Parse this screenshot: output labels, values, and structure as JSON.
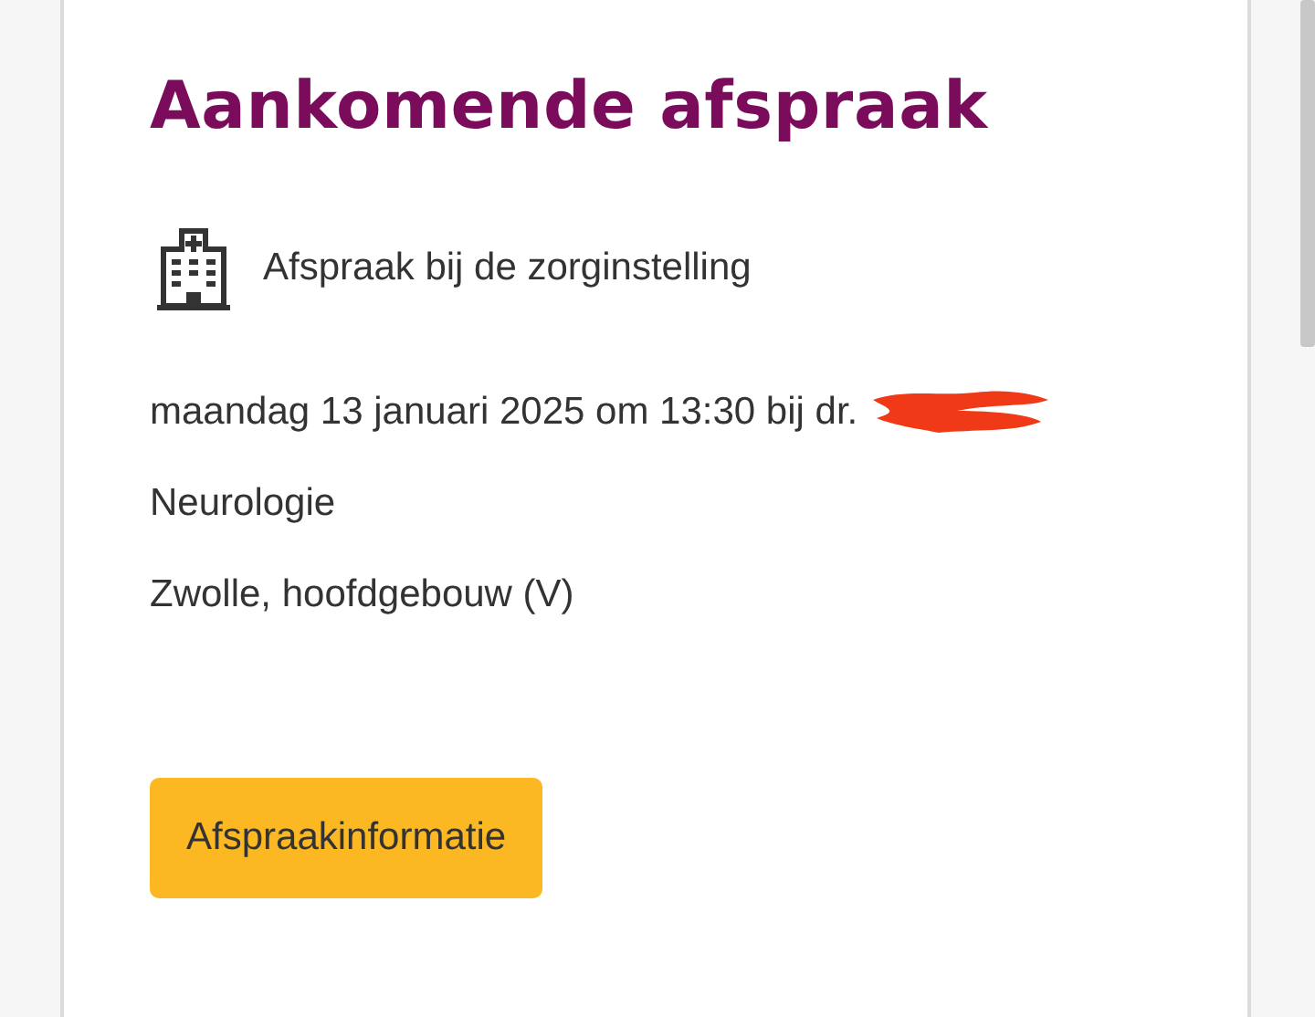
{
  "appointment_card": {
    "title": "Aankomende afspraak",
    "type_label": "Afspraak bij de zorginstelling",
    "details": [
      "maandag 13 januari 2025 om 13:30 bij dr.",
      "Neurologie",
      "Zwolle, hoofdgebouw (V)"
    ],
    "redacted": true,
    "button": "Afspraakinformatie"
  }
}
